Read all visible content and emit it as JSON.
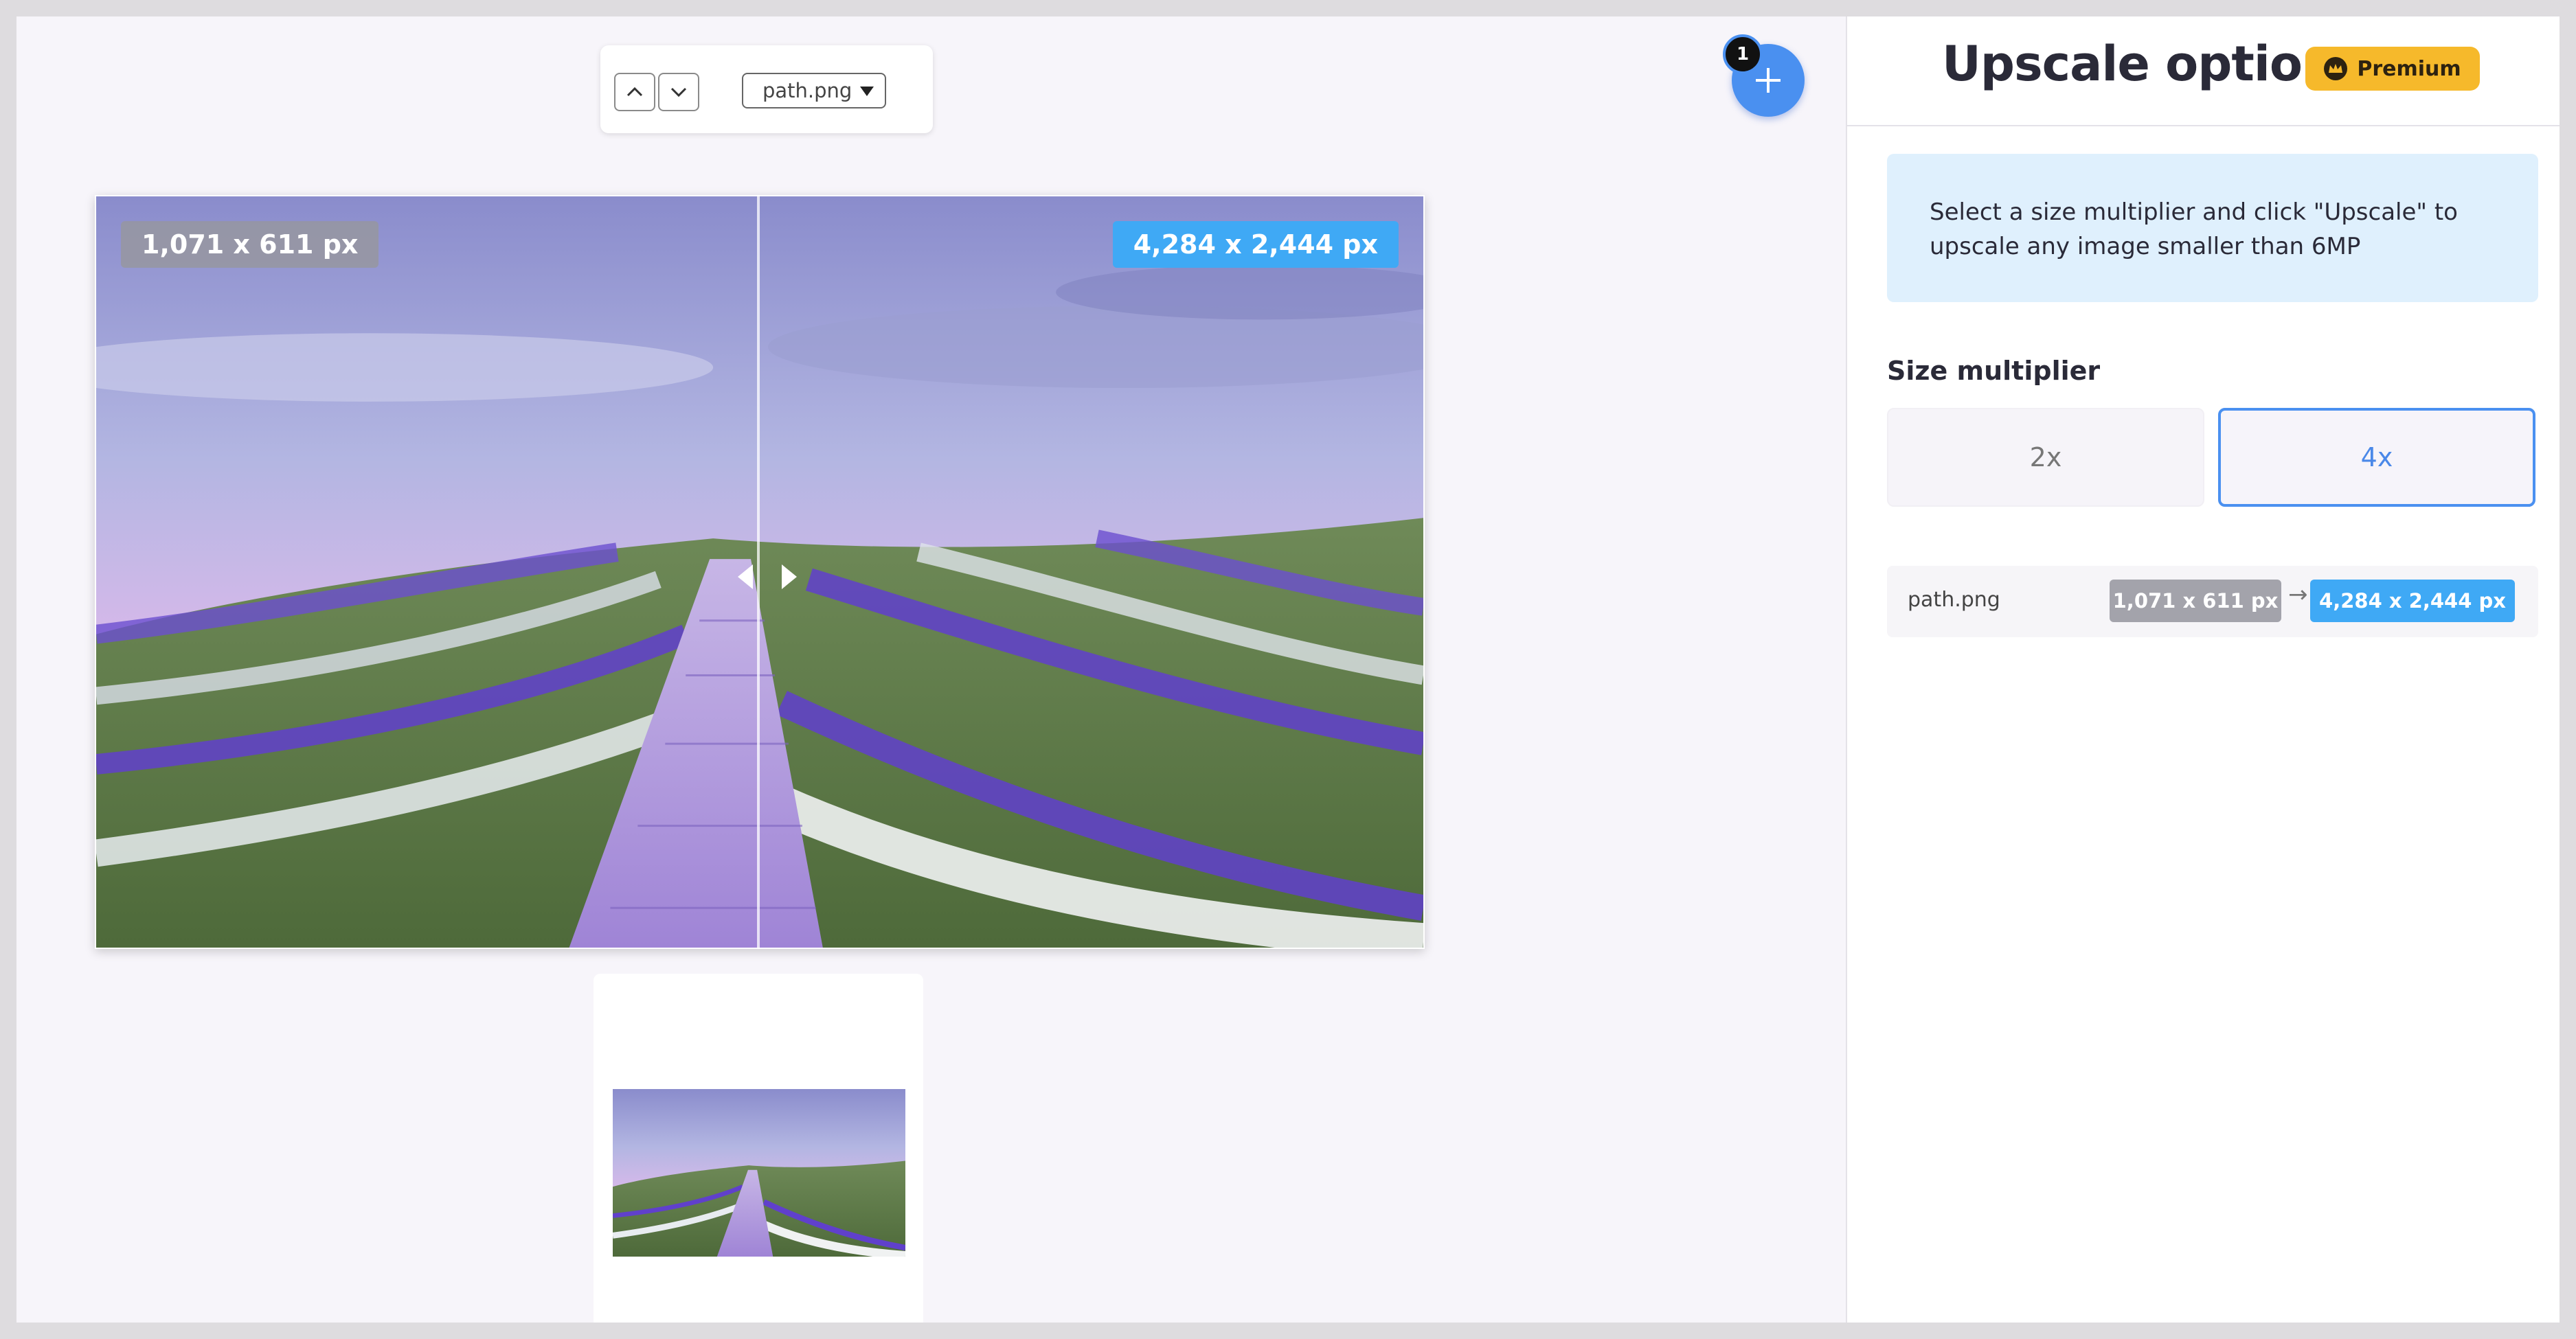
{
  "toolbar": {
    "file_name": "path.png",
    "icons": {
      "prev": "chevron-up-icon",
      "next": "chevron-down-icon",
      "dropdown": "caret-down-icon"
    }
  },
  "add_button": {
    "badge_count": "1",
    "icon": "plus-icon"
  },
  "preview": {
    "original_size": "1,071 x 611 px",
    "upscaled_size": "4,284 x 2,444 px"
  },
  "panel": {
    "title": "Upscale options",
    "premium_label": "Premium",
    "info_text": "Select a size multiplier and click \"Upscale\" to upscale any image smaller than 6MP",
    "size_label": "Size multiplier",
    "multipliers": [
      {
        "label": "2x",
        "selected": false
      },
      {
        "label": "4x",
        "selected": true
      }
    ],
    "files": [
      {
        "name": "path.png",
        "original": "1,071 x 611 px",
        "upscaled": "4,284 x 2,444 px"
      }
    ]
  },
  "colors": {
    "accent": "#4a90f0",
    "upscaled_tag": "#3fa9f5",
    "premium": "#f6b92b",
    "info_bg": "#dff0fd"
  }
}
